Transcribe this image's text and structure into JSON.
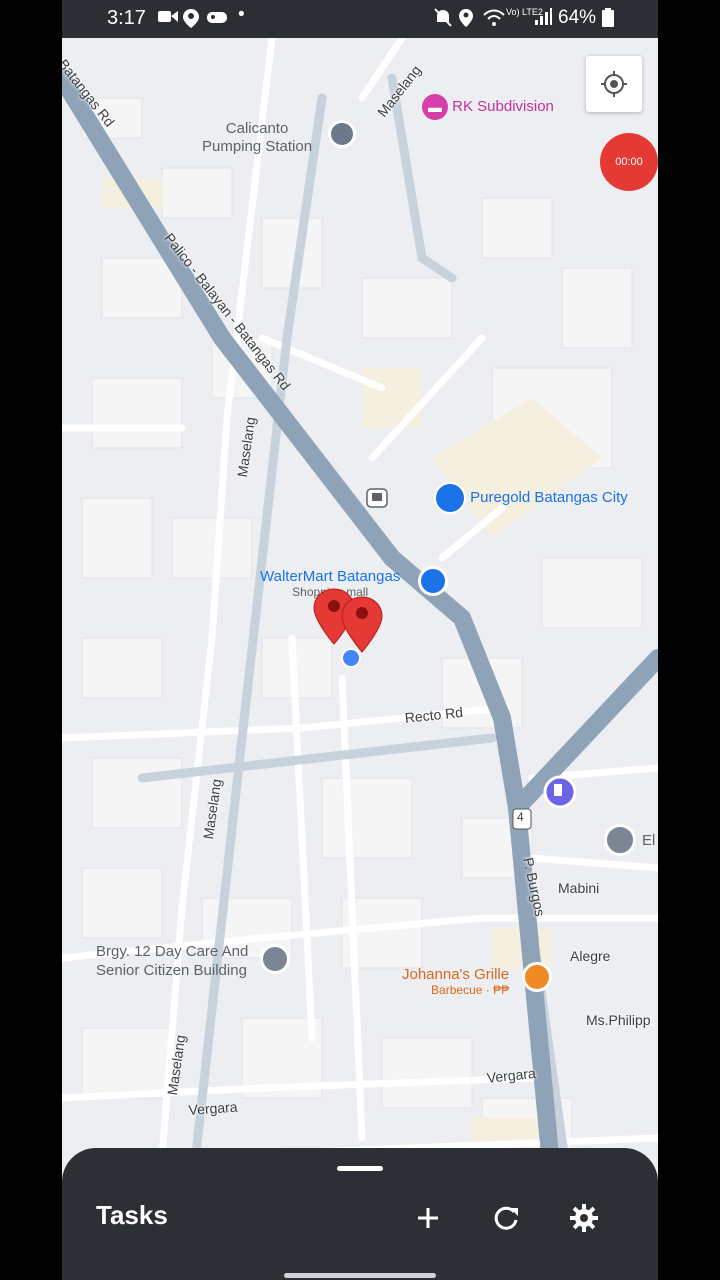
{
  "status_bar": {
    "time": "3:17",
    "dot": "•",
    "battery": "64%",
    "network": "Vo) LTE2"
  },
  "map": {
    "pois": {
      "rk_subdivision": "RK Subdivision",
      "calicanto_line1": "Calicanto",
      "calicanto_line2": "Pumping Station",
      "puregold": "Puregold Batangas City",
      "waltermart": "WalterMart Batangas",
      "waltermart_sub": "Shopping mall",
      "daycare_line1": "Brgy. 12 Day Care And",
      "daycare_line2": "Senior Citizen Building",
      "johannas": "Johanna's Grille",
      "johannas_sub": "Barbecue · ₱₱",
      "el_partial": "El"
    },
    "streets": {
      "maselang_top": "Maselang",
      "palico_road": "Palico - Balayan - Batangas Rd",
      "batangas_rd_top": "Batangas Rd",
      "maselang_mid": "Maselang",
      "maselang_low": "Maselang",
      "maselang_bottom": "Maselang",
      "recto": "Recto Rd",
      "p_burgos": "P. Burgos",
      "mabini": "Mabini",
      "alegre": "Alegre",
      "ms_philipp": "Ms.Philipp",
      "vergara_right": "Vergara",
      "vergara_left": "Vergara",
      "route_shield": "4"
    },
    "recording_time": "00:00"
  },
  "bottom_sheet": {
    "title": "Tasks"
  },
  "colors": {
    "road_main": "#8fa3b8",
    "road_minor": "#ffffff",
    "marker": "#e53935",
    "sheet_bg": "#2c3034",
    "record_btn": "#e53935"
  }
}
